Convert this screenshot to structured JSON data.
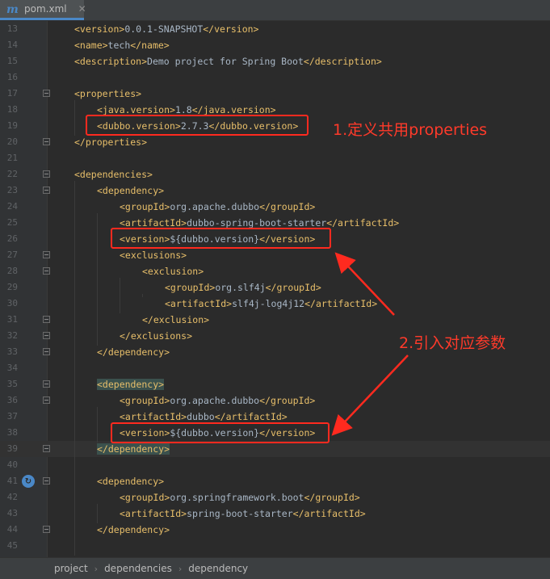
{
  "tab": {
    "label": "pom.xml",
    "icon": "maven-m-icon",
    "close": "✕"
  },
  "editor": {
    "lines": [
      {
        "n": "13",
        "indent": 1,
        "parts": [
          [
            "tag",
            "<version>"
          ],
          [
            "txt",
            "0.0.1-SNAPSHOT"
          ],
          [
            "tag",
            "</version>"
          ]
        ]
      },
      {
        "n": "14",
        "indent": 1,
        "parts": [
          [
            "tag",
            "<name>"
          ],
          [
            "txt",
            "tech"
          ],
          [
            "tag",
            "</name>"
          ]
        ]
      },
      {
        "n": "15",
        "indent": 1,
        "parts": [
          [
            "tag",
            "<description>"
          ],
          [
            "txt",
            "Demo project for Spring Boot"
          ],
          [
            "tag",
            "</description>"
          ]
        ]
      },
      {
        "n": "16",
        "indent": 0,
        "parts": []
      },
      {
        "n": "17",
        "indent": 1,
        "parts": [
          [
            "tag",
            "<properties>"
          ]
        ]
      },
      {
        "n": "18",
        "indent": 2,
        "parts": [
          [
            "tag",
            "<java.version>"
          ],
          [
            "txt",
            "1.8"
          ],
          [
            "tag",
            "</java.version>"
          ]
        ]
      },
      {
        "n": "19",
        "indent": 2,
        "parts": [
          [
            "tag",
            "<dubbo.version>"
          ],
          [
            "txt",
            "2.7.3"
          ],
          [
            "tag",
            "</dubbo.version>"
          ]
        ]
      },
      {
        "n": "20",
        "indent": 1,
        "parts": [
          [
            "tag",
            "</properties>"
          ]
        ]
      },
      {
        "n": "21",
        "indent": 0,
        "parts": []
      },
      {
        "n": "22",
        "indent": 1,
        "parts": [
          [
            "tag",
            "<dependencies>"
          ]
        ]
      },
      {
        "n": "23",
        "indent": 2,
        "parts": [
          [
            "tag",
            "<dependency>"
          ]
        ]
      },
      {
        "n": "24",
        "indent": 3,
        "parts": [
          [
            "tag",
            "<groupId>"
          ],
          [
            "txt",
            "org.apache.dubbo"
          ],
          [
            "tag",
            "</groupId>"
          ]
        ]
      },
      {
        "n": "25",
        "indent": 3,
        "parts": [
          [
            "tag",
            "<artifactId>"
          ],
          [
            "txt",
            "dubbo-spring-boot-starter"
          ],
          [
            "tag",
            "</artifactId>"
          ]
        ]
      },
      {
        "n": "26",
        "indent": 3,
        "parts": [
          [
            "tag",
            "<version>"
          ],
          [
            "txt",
            "${dubbo.version}"
          ],
          [
            "tag",
            "</version>"
          ]
        ]
      },
      {
        "n": "27",
        "indent": 3,
        "parts": [
          [
            "tag",
            "<exclusions>"
          ]
        ]
      },
      {
        "n": "28",
        "indent": 4,
        "parts": [
          [
            "tag",
            "<exclusion>"
          ]
        ]
      },
      {
        "n": "29",
        "indent": 5,
        "parts": [
          [
            "tag",
            "<groupId>"
          ],
          [
            "txt",
            "org.slf4j"
          ],
          [
            "tag",
            "</groupId>"
          ]
        ]
      },
      {
        "n": "30",
        "indent": 5,
        "parts": [
          [
            "tag",
            "<artifactId>"
          ],
          [
            "txt",
            "slf4j-log4j12"
          ],
          [
            "tag",
            "</artifactId>"
          ]
        ]
      },
      {
        "n": "31",
        "indent": 4,
        "parts": [
          [
            "tag",
            "</exclusion>"
          ]
        ]
      },
      {
        "n": "32",
        "indent": 3,
        "parts": [
          [
            "tag",
            "</exclusions>"
          ]
        ]
      },
      {
        "n": "33",
        "indent": 2,
        "parts": [
          [
            "tag",
            "</dependency>"
          ]
        ]
      },
      {
        "n": "34",
        "indent": 0,
        "parts": []
      },
      {
        "n": "35",
        "indent": 2,
        "parts": [
          [
            "hl",
            "<dependency>"
          ]
        ]
      },
      {
        "n": "36",
        "indent": 3,
        "parts": [
          [
            "tag",
            "<groupId>"
          ],
          [
            "txt",
            "org.apache.dubbo"
          ],
          [
            "tag",
            "</groupId>"
          ]
        ]
      },
      {
        "n": "37",
        "indent": 3,
        "parts": [
          [
            "tag",
            "<artifactId>"
          ],
          [
            "txt",
            "dubbo"
          ],
          [
            "tag",
            "</artifactId>"
          ]
        ]
      },
      {
        "n": "38",
        "indent": 3,
        "parts": [
          [
            "tag",
            "<version>"
          ],
          [
            "txt",
            "${dubbo.version}"
          ],
          [
            "tag",
            "</version>"
          ]
        ]
      },
      {
        "n": "39",
        "indent": 2,
        "parts": [
          [
            "hl",
            "</dependency>"
          ]
        ]
      },
      {
        "n": "40",
        "indent": 0,
        "parts": []
      },
      {
        "n": "41",
        "indent": 2,
        "parts": [
          [
            "tag",
            "<dependency>"
          ]
        ]
      },
      {
        "n": "42",
        "indent": 3,
        "parts": [
          [
            "tag",
            "<groupId>"
          ],
          [
            "txt",
            "org.springframework.boot"
          ],
          [
            "tag",
            "</groupId>"
          ]
        ]
      },
      {
        "n": "43",
        "indent": 3,
        "parts": [
          [
            "tag",
            "<artifactId>"
          ],
          [
            "txt",
            "spring-boot-starter"
          ],
          [
            "tag",
            "</artifactId>"
          ]
        ]
      },
      {
        "n": "44",
        "indent": 2,
        "parts": [
          [
            "tag",
            "</dependency>"
          ]
        ]
      },
      {
        "n": "45",
        "indent": 0,
        "parts": []
      }
    ],
    "current_line": "39",
    "gutter_marker_icon": "run-gutter-icon"
  },
  "annotations": {
    "note1": "1.定义共用properties",
    "note2": "2.引入对应参数"
  },
  "colors": {
    "annotation": "#ff2a1f",
    "tag": "#e8bf6a",
    "text": "#a9b7c6",
    "background": "#2b2b2b"
  },
  "breadcrumb": [
    "project",
    "dependencies",
    "dependency"
  ]
}
